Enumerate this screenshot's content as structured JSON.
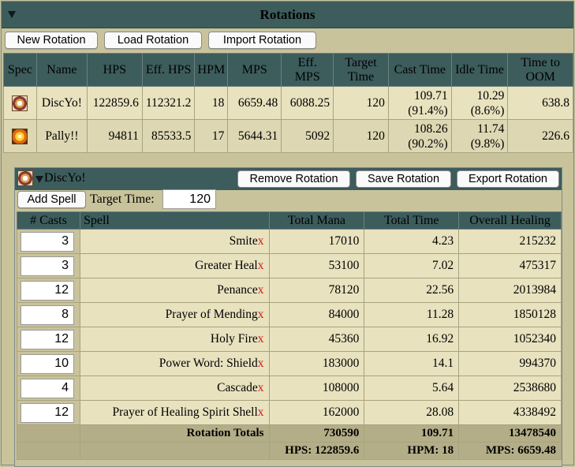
{
  "header": {
    "title": "Rotations"
  },
  "toolbar": {
    "new_rotation": "New Rotation",
    "load_rotation": "Load Rotation",
    "import_rotation": "Import Rotation"
  },
  "rotations_table": {
    "headers": {
      "spec": "Spec",
      "name": "Name",
      "hps": "HPS",
      "eff_hps": "Eff. HPS",
      "hpm": "HPM",
      "mps": "MPS",
      "eff_mps": "Eff. MPS",
      "target_time": "Target Time",
      "cast_time": "Cast Time",
      "idle_time": "Idle Time",
      "time_to_oom": "Time to OOM"
    },
    "rows": [
      {
        "icon": "disc-priest-icon",
        "name": "DiscYo!",
        "hps": "122859.6",
        "eff_hps": "112321.2",
        "hpm": "18",
        "mps": "6659.48",
        "eff_mps": "6088.25",
        "target_time": "120",
        "cast_time": "109.71",
        "cast_pct": "(91.4%)",
        "idle_time": "10.29",
        "idle_pct": "(8.6%)",
        "time_to_oom": "638.8"
      },
      {
        "icon": "holy-paladin-icon",
        "name": "Pally!!",
        "hps": "94811",
        "eff_hps": "85533.5",
        "hpm": "17",
        "mps": "5644.31",
        "eff_mps": "5092",
        "target_time": "120",
        "cast_time": "108.26",
        "cast_pct": "(90.2%)",
        "idle_time": "11.74",
        "idle_pct": "(9.8%)",
        "time_to_oom": "226.6"
      }
    ]
  },
  "detail": {
    "name": "DiscYo!",
    "remove_rotation": "Remove Rotation",
    "save_rotation": "Save Rotation",
    "export_rotation": "Export Rotation",
    "add_spell": "Add Spell",
    "target_time_label": "Target Time:",
    "target_time_value": "120",
    "headers": {
      "casts": "# Casts",
      "spell": "Spell",
      "total_mana": "Total Mana",
      "total_time": "Total Time",
      "overall_healing": "Overall Healing"
    },
    "remove_glyph": "x",
    "spells": [
      {
        "casts": "3",
        "spell": "Smite",
        "mana": "17010",
        "time": "4.23",
        "healing": "215232"
      },
      {
        "casts": "3",
        "spell": "Greater Heal",
        "mana": "53100",
        "time": "7.02",
        "healing": "475317"
      },
      {
        "casts": "12",
        "spell": "Penance",
        "mana": "78120",
        "time": "22.56",
        "healing": "2013984"
      },
      {
        "casts": "8",
        "spell": "Prayer of Mending",
        "mana": "84000",
        "time": "11.28",
        "healing": "1850128"
      },
      {
        "casts": "12",
        "spell": "Holy Fire",
        "mana": "45360",
        "time": "16.92",
        "healing": "1052340"
      },
      {
        "casts": "10",
        "spell": "Power Word: Shield",
        "mana": "183000",
        "time": "14.1",
        "healing": "994370"
      },
      {
        "casts": "4",
        "spell": "Cascade",
        "mana": "108000",
        "time": "5.64",
        "healing": "2538680"
      },
      {
        "casts": "12",
        "spell": "Prayer of Healing Spirit Shell",
        "mana": "162000",
        "time": "28.08",
        "healing": "4338492"
      }
    ],
    "totals": {
      "label": "Rotation Totals",
      "mana": "730590",
      "time": "109.71",
      "healing": "13478540",
      "hps": "HPS: 122859.6",
      "hpm": "HPM: 18",
      "mps": "MPS: 6659.48"
    }
  }
}
